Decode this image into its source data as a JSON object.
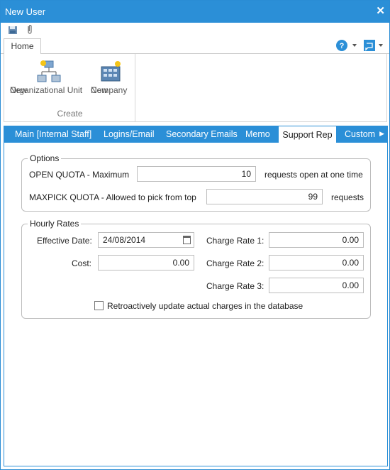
{
  "window": {
    "title": "New User"
  },
  "ribbon": {
    "tab_home": "Home",
    "buttons": [
      {
        "line1": "New",
        "line2": "Organizational Unit"
      },
      {
        "line1": "New",
        "line2": "Company"
      }
    ],
    "group_label": "Create"
  },
  "tabs": [
    "Main [Internal Staff]",
    "Logins/Email",
    "Secondary Emails",
    "Memo",
    "Support Rep",
    "Custom"
  ],
  "options": {
    "legend": "Options",
    "open_quota_label": "OPEN QUOTA - Maximum",
    "open_quota_value": "10",
    "open_quota_suffix": "requests open at one time",
    "maxpick_label": "MAXPICK QUOTA - Allowed to pick from top",
    "maxpick_value": "99",
    "maxpick_suffix": "requests"
  },
  "hourly": {
    "legend": "Hourly Rates",
    "effective_date_label": "Effective Date:",
    "effective_date_value": "24/08/2014",
    "cost_label": "Cost:",
    "cost_value": "0.00",
    "charge1_label": "Charge Rate 1:",
    "charge1_value": "0.00",
    "charge2_label": "Charge Rate 2:",
    "charge2_value": "0.00",
    "charge3_label": "Charge Rate 3:",
    "charge3_value": "0.00",
    "retro_label": "Retroactively update actual charges in the database"
  },
  "colors": {
    "accent": "#2b8fd7"
  }
}
